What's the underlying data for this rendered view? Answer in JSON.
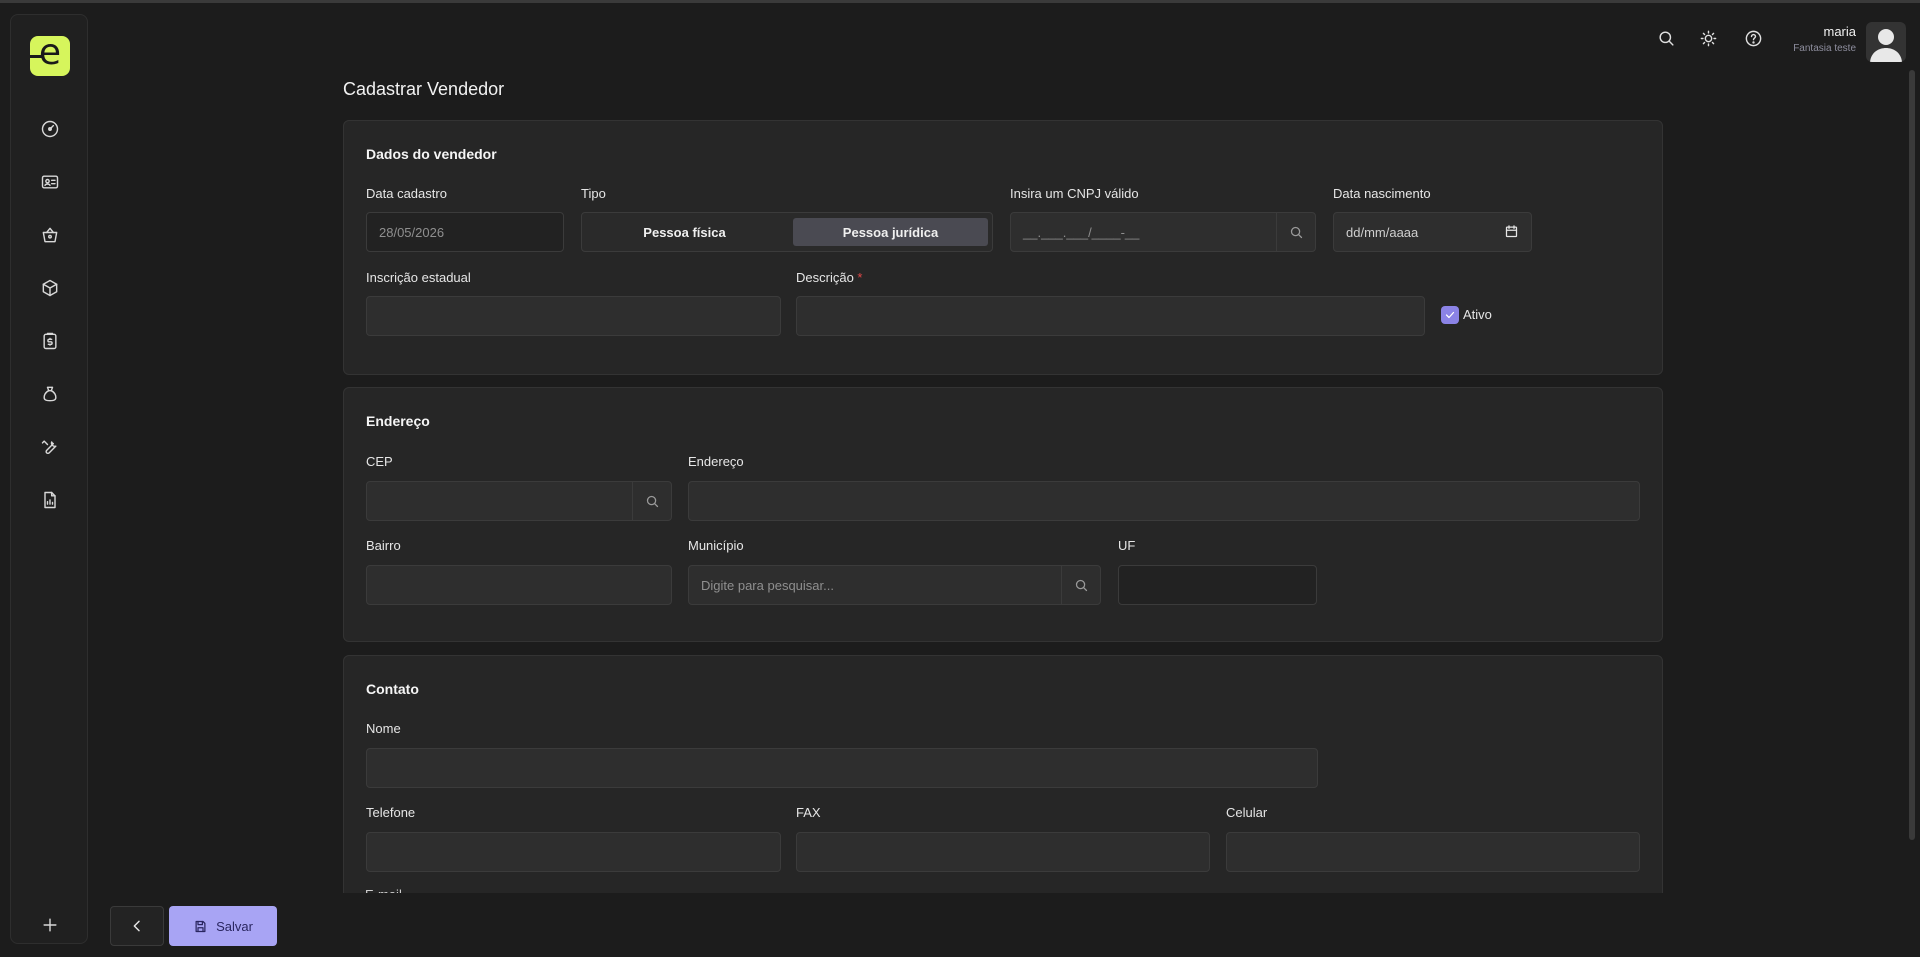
{
  "header": {
    "user_name": "maria",
    "user_company": "Fantasia teste",
    "icons": [
      "search-icon",
      "sun-icon",
      "help-icon"
    ]
  },
  "sidebar": {
    "logo_letter": "e",
    "items": [
      "dashboard-icon",
      "id-card-icon",
      "basket-icon",
      "box-icon",
      "clipboard-dollar-icon",
      "money-bag-icon",
      "wrench-icon",
      "report-icon"
    ],
    "add_icon": "plus-icon"
  },
  "page": {
    "title": "Cadastrar Vendedor"
  },
  "dados": {
    "title": "Dados do vendedor",
    "data_cadastro_label": "Data cadastro",
    "data_cadastro_value": "28/05/2026",
    "tipo_label": "Tipo",
    "tipo_options": [
      "Pessoa física",
      "Pessoa jurídica"
    ],
    "tipo_selected": "Pessoa jurídica",
    "cnpj_label": "Insira um CNPJ válido",
    "cnpj_placeholder": "__.___.___/____-__",
    "nascimento_label": "Data nascimento",
    "nascimento_placeholder": "dd/mm/aaaa",
    "inscricao_label": "Inscrição estadual",
    "descricao_label": "Descrição",
    "required_mark": "*",
    "ativo_label": "Ativo",
    "ativo_checked": true
  },
  "endereco": {
    "title": "Endereço",
    "cep_label": "CEP",
    "endereco_label": "Endereço",
    "bairro_label": "Bairro",
    "municipio_label": "Município",
    "municipio_placeholder": "Digite para pesquisar...",
    "uf_label": "UF"
  },
  "contato": {
    "title": "Contato",
    "nome_label": "Nome",
    "telefone_label": "Telefone",
    "fax_label": "FAX",
    "celular_label": "Celular",
    "email_label_partial": "E-mail"
  },
  "footer": {
    "save_label": "Salvar"
  },
  "colors": {
    "accent": "#a8a4f4",
    "logo": "#d6f55c",
    "checkbox": "#8b83e6",
    "background": "#1c1c1c",
    "card": "#262626"
  }
}
